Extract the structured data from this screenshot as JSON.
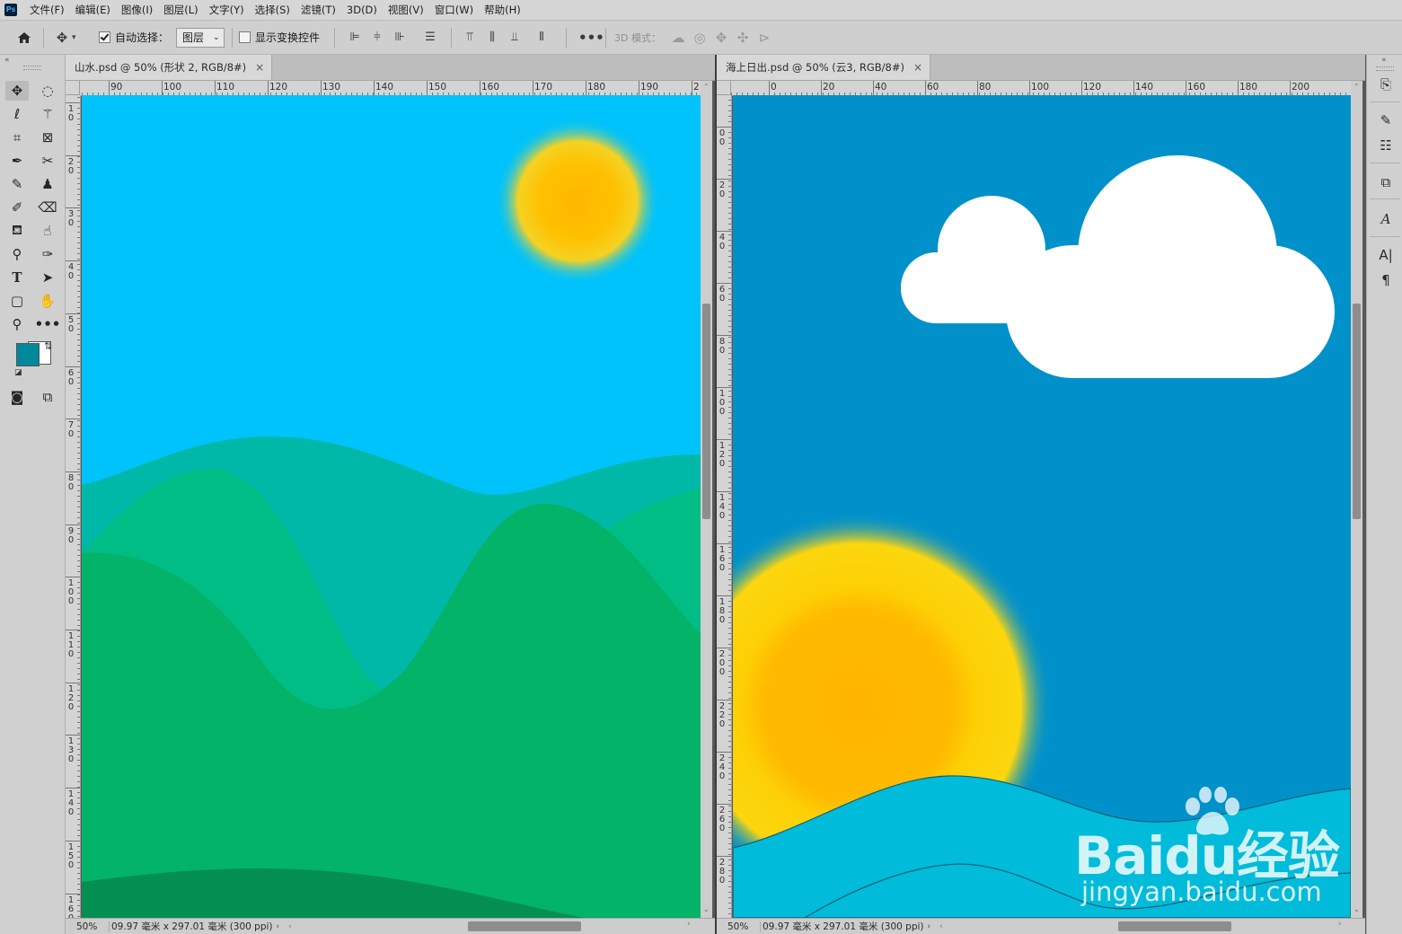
{
  "app": {
    "logo": "Ps"
  },
  "menu": [
    "文件(F)",
    "编辑(E)",
    "图像(I)",
    "图层(L)",
    "文字(Y)",
    "选择(S)",
    "滤镜(T)",
    "3D(D)",
    "视图(V)",
    "窗口(W)",
    "帮助(H)"
  ],
  "options": {
    "auto_select_label": "自动选择：",
    "auto_select_checked": true,
    "layer_select_value": "图层",
    "show_transform_label": "显示变换控件",
    "show_transform_checked": false,
    "mode_3d_label": "3D 模式："
  },
  "colors": {
    "foreground": "#00889c",
    "background": "#ffffff"
  },
  "doc1": {
    "tab_title": "山水.psd @ 50% (形状 2, RGB/8#)",
    "ruler_h": [
      "90",
      "100",
      "110",
      "120",
      "130",
      "140",
      "150",
      "160",
      "170",
      "180",
      "190",
      "2"
    ],
    "ruler_v": [
      "1",
      "2",
      "3",
      "4",
      "5",
      "6",
      "7",
      "8",
      "9",
      "10",
      "11",
      "12",
      "13",
      "14",
      "15",
      "16"
    ],
    "zoom": "50%",
    "doc_info": "09.97 毫米 x 297.01 毫米 (300 ppi)"
  },
  "doc2": {
    "tab_title": "海上日出.psd @ 50% (云3, RGB/8#)",
    "ruler_h": [
      "0",
      "20",
      "40",
      "60",
      "80",
      "100",
      "120",
      "140",
      "160",
      "180",
      "200"
    ],
    "ruler_v": [
      "0",
      "2",
      "4",
      "6",
      "8",
      "10",
      "12",
      "14",
      "16",
      "18",
      "20",
      "22",
      "24",
      "26",
      "28"
    ],
    "zoom": "50%",
    "doc_info": "09.97 毫米 x 297.01 毫米 (300 ppi)"
  },
  "watermark": {
    "brand": "Baidu经验",
    "url": "jingyan.baidu.com"
  }
}
